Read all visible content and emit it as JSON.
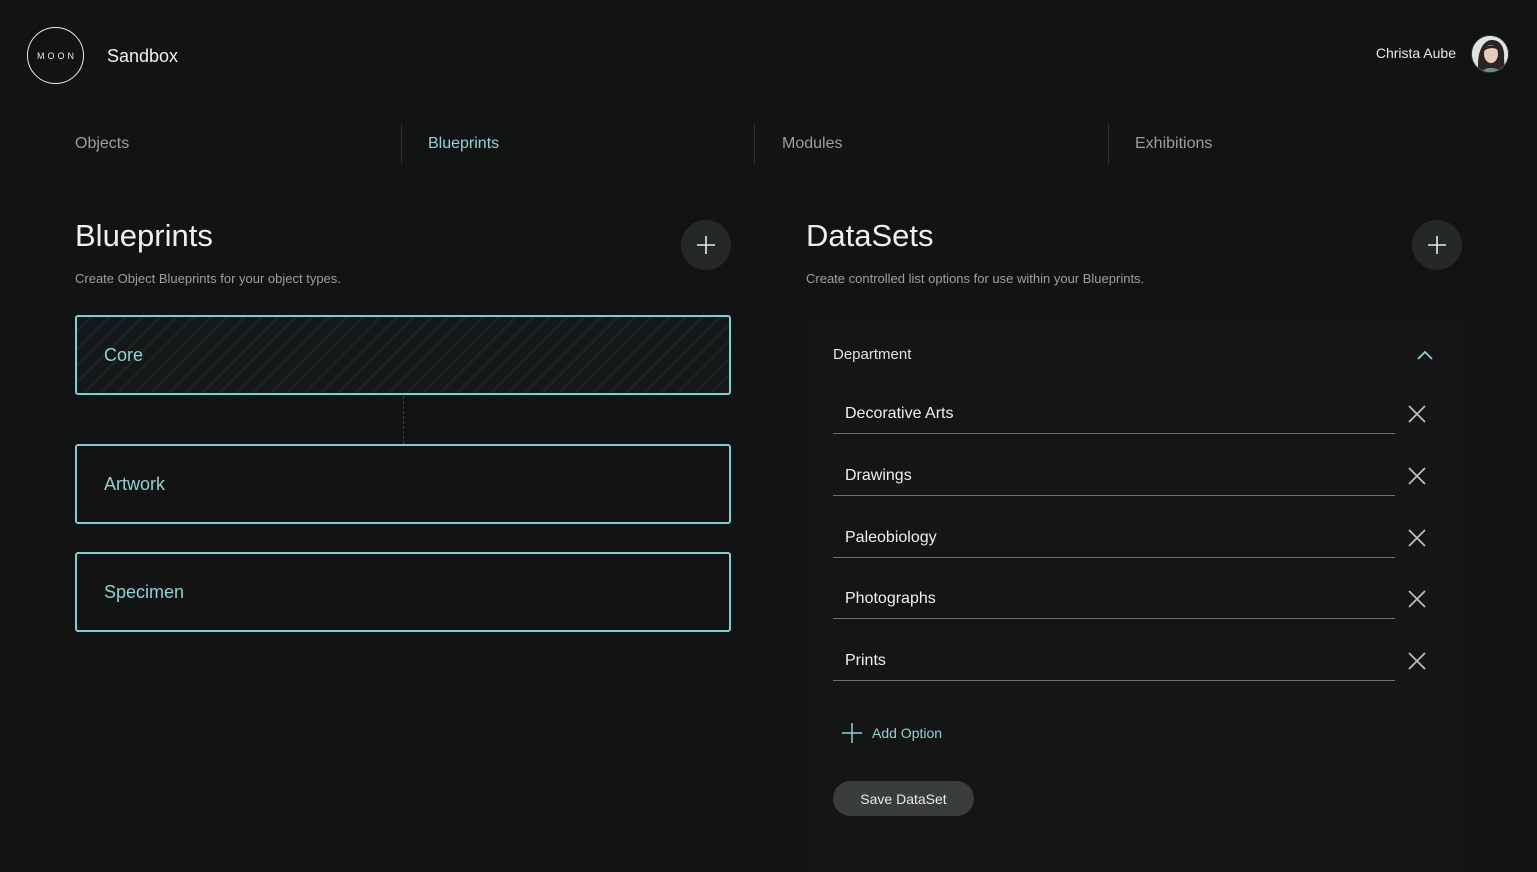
{
  "header": {
    "logo_text": "MOON",
    "workspace": "Sandbox",
    "user_name": "Christa Aube"
  },
  "tabs": [
    {
      "label": "Objects",
      "active": false
    },
    {
      "label": "Blueprints",
      "active": true
    },
    {
      "label": "Modules",
      "active": false
    },
    {
      "label": "Exhibitions",
      "active": false
    }
  ],
  "blueprints": {
    "title": "Blueprints",
    "subtitle": "Create Object Blueprints for your object types.",
    "items": [
      "Core",
      "Artwork",
      "Specimen"
    ]
  },
  "datasets": {
    "title": "DataSets",
    "subtitle": "Create controlled list options for use within your Blueprints.",
    "current": {
      "name": "Department",
      "options": [
        "Decorative Arts",
        "Drawings",
        "Paleobiology",
        "Photographs",
        "Prints"
      ]
    },
    "add_option_label": "Add Option",
    "save_label": "Save DataSet"
  },
  "colors": {
    "background": "#121414",
    "accent": "#8fd3d4",
    "muted_text": "#9a9fa0"
  }
}
